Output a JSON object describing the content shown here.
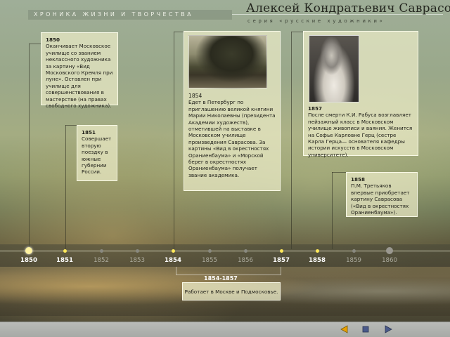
{
  "header": {
    "section": "ХРОНИКА ЖИЗНИ И ТВОРЧЕСТВА",
    "artist": "Алексей Кондратьевич Саврасов",
    "series": "серия «русские художники»"
  },
  "events": {
    "e1850": {
      "year": "1850",
      "text": "Оканчивает Московское училище со званием неклассного художника за картину «Вид Московского Кремля при луне». Оставлен при училище для совершенствования в мастерстве (на правах свободного художника)."
    },
    "e1851": {
      "year": "1851",
      "text": "Совершает вторую поездку в южные губернии России."
    },
    "e1854": {
      "year": "1854",
      "text": "Едет в Петербург по приглашению великой княгини Марии Николаевны (президента Академии художеств), отметившей на выставке в Московском училище произведения Саврасова. За картины «Вид в окрестностях Ораниенбаума» и «Морской берег в окрестностях Ораниенбаума» получает звание академика."
    },
    "e1857": {
      "year": "1857",
      "text": "После смерти К.И. Рабуса возглавляет пейзажный класс в Московском училище живописи и ваяния. Женится на Софье Карловне Герц (сестре Карла Герца— основателя кафедры истории искусств в Московском университете)."
    },
    "e1858": {
      "year": "1858",
      "text": "П.М. Третьяков впервые приобретает картину Саврасова («Вид в окрестностях Ораниенбаума»)."
    },
    "span": {
      "label": "1854-1857",
      "text": "Работает в Москве и Подмосковье."
    }
  },
  "timeline": {
    "years": [
      "1850",
      "1851",
      "1852",
      "1853",
      "1854",
      "1855",
      "1856",
      "1857",
      "1858",
      "1859",
      "1860"
    ],
    "active": [
      "1850",
      "1851",
      "1854",
      "1857",
      "1858"
    ]
  },
  "nav": {
    "prev": "prev-icon",
    "stop": "stop-icon",
    "next": "next-icon"
  },
  "colors": {
    "accent_dot": "#ffe95a",
    "nav_arrow": "#e8a000"
  }
}
